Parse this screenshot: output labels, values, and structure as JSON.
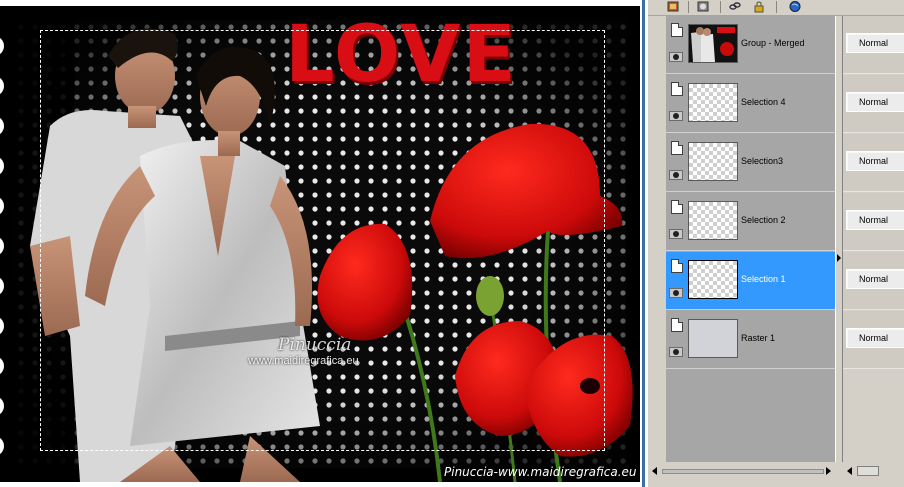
{
  "artwork": {
    "title": "LOVE",
    "watermark_name": "Pinuccia",
    "watermark_url": "www.maidiregrafica.eu",
    "credit": "Pinuccia-www.maidiregrafica.eu"
  },
  "colors": {
    "accent_red": "#d90d14",
    "selection_blue": "#3399ff",
    "layer_row_gray": "#a6a6a6",
    "panel_gray": "#d4d0c8"
  },
  "toolbar": {
    "icons": [
      "new-layer-icon",
      "mask-icon",
      "link-icon",
      "lock-icon",
      "globe-icon"
    ]
  },
  "layers": [
    {
      "name": "Group - Merged",
      "thumbnail": "image",
      "blend_mode": "Normal",
      "selected": false,
      "visible": true
    },
    {
      "name": "Selection 4",
      "thumbnail": "transparent",
      "blend_mode": "Normal",
      "selected": false,
      "visible": true
    },
    {
      "name": "Selection3",
      "thumbnail": "transparent",
      "blend_mode": "Normal",
      "selected": false,
      "visible": true
    },
    {
      "name": "Selection 2",
      "thumbnail": "transparent",
      "blend_mode": "Normal",
      "selected": false,
      "visible": true
    },
    {
      "name": "Selection 1",
      "thumbnail": "transparent",
      "blend_mode": "Normal",
      "selected": true,
      "visible": true
    },
    {
      "name": "Raster 1",
      "thumbnail": "solid",
      "blend_mode": "Normal",
      "selected": false,
      "visible": true
    }
  ]
}
